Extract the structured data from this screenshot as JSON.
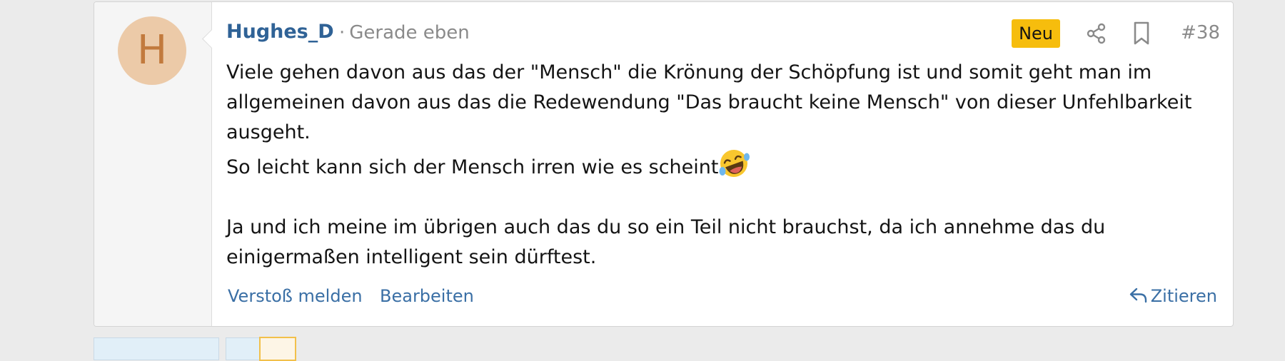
{
  "post": {
    "avatar_letter": "H",
    "username": "Hughes_D",
    "time_sep": "·",
    "time": "Gerade eben",
    "badge": "Neu",
    "post_number": "#38",
    "body": {
      "line1": "Viele gehen davon aus das der \"Mensch\" die Krönung der Schöpfung ist und somit geht man im allgemeinen davon aus das die Redewendung \"Das braucht keine Mensch\" von dieser Unfehlbarkeit ausgeht.",
      "line2": "So leicht kann sich der Mensch irren wie es scheint",
      "line3": "Ja und ich meine im übrigen auch das du so ein Teil nicht brauchst, da ich annehme das du einigermaßen intelligent sein dürftest."
    },
    "actions": {
      "report": "Verstoß melden",
      "edit": "Bearbeiten",
      "quote": "Zitieren"
    }
  },
  "colors": {
    "link": "#2f6296",
    "badge": "#f6bd0d",
    "avatar_bg": "#eccaa8",
    "avatar_fg": "#c27a3d"
  },
  "icons": [
    "share-icon",
    "bookmark-icon",
    "reply-icon",
    "rofl-emoji"
  ]
}
